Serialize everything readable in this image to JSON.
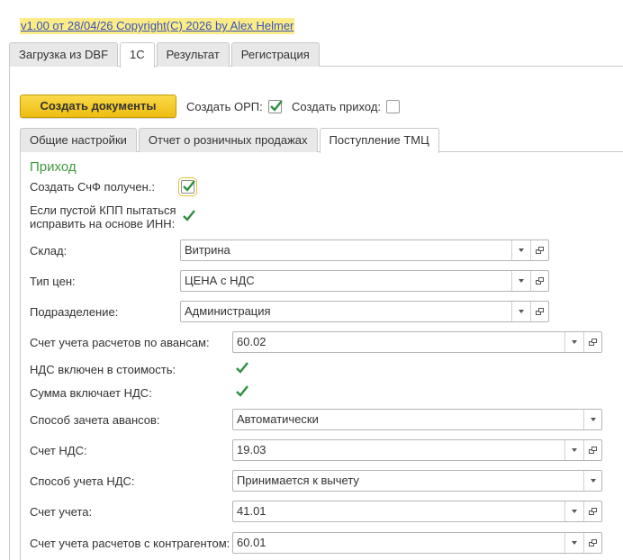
{
  "header": {
    "version_text": "v1.00 от 28/04/26  Copyright(C)  2026   by Alex Helmer"
  },
  "main_tabs": [
    {
      "label": "Загрузка из DBF",
      "active": false
    },
    {
      "label": "1С",
      "active": true
    },
    {
      "label": "Результат",
      "active": false
    },
    {
      "label": "Регистрация",
      "active": false
    }
  ],
  "toolbar": {
    "create_button": "Создать документы",
    "create_orp_label": "Создать ОРП:",
    "create_orp_checked": true,
    "create_income_label": "Создать приход:",
    "create_income_checked": false
  },
  "sub_tabs": [
    {
      "label": "Общие настройки",
      "active": false
    },
    {
      "label": "Отчет о розничных продажах",
      "active": false
    },
    {
      "label": "Поступление ТМЦ",
      "active": true
    }
  ],
  "income": {
    "section_title": "Приход",
    "create_invoice_label": "Создать СчФ получен.:",
    "create_invoice_checked": true,
    "fix_kpp_label_line1": "Если пустой КПП пытаться",
    "fix_kpp_label_line2": "исправить на основе ИНН:",
    "fix_kpp_checked": true,
    "warehouse_label": "Склад:",
    "warehouse_value": "Витрина",
    "price_type_label": "Тип цен:",
    "price_type_value": "ЦЕНА с НДС",
    "division_label": "Подразделение:",
    "division_value": "Администрация",
    "advance_account_label": "Счет учета расчетов по авансам:",
    "advance_account_value": "60.02",
    "vat_in_cost_label": "НДС включен в стоимость:",
    "vat_in_cost_checked": true,
    "sum_includes_vat_label": "Сумма включает НДС:",
    "sum_includes_vat_checked": true,
    "advance_offset_label": "Способ зачета авансов:",
    "advance_offset_value": "Автоматически",
    "vat_account_label": "Счет НДС:",
    "vat_account_value": "19.03",
    "vat_method_label": "Способ учета НДС:",
    "vat_method_value": "Принимается к вычету",
    "account_label": "Счет учета:",
    "account_value": "41.01",
    "contractor_account_label": "Счет учета расчетов с контрагентом:",
    "contractor_account_value": "60.01"
  },
  "colors": {
    "accent_green": "#3d9a3d",
    "button_yellow": "#f5cb2a",
    "link_blue": "#3a52b8"
  }
}
